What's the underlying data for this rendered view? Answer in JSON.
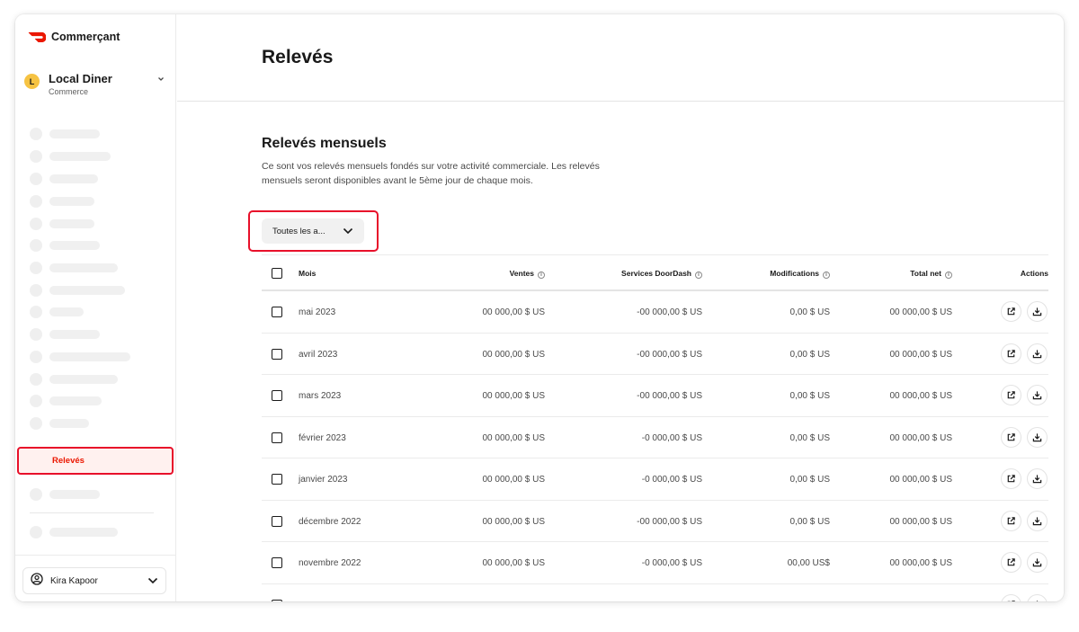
{
  "app": {
    "brand": "Commerçant"
  },
  "store": {
    "avatar_letter": "L",
    "name": "Local Diner",
    "subtitle": "Commerce"
  },
  "sidebar": {
    "active_item": "Relevés"
  },
  "user": {
    "name": "Kira Kapoor"
  },
  "page": {
    "title": "Relevés"
  },
  "section": {
    "title": "Relevés mensuels",
    "description": "Ce sont vos relevés mensuels fondés sur votre activité commerciale. Les relevés mensuels seront disponibles avant le 5ème jour de chaque mois."
  },
  "filter": {
    "label": "Toutes les a..."
  },
  "table": {
    "headers": {
      "month": "Mois",
      "sales": "Ventes",
      "services": "Services DoorDash",
      "modifications": "Modifications",
      "net": "Total net",
      "actions": "Actions"
    },
    "rows": [
      {
        "month": "mai 2023",
        "sales": "00 000,00 $ US",
        "services": "-00 000,00 $ US",
        "modifications": "0,00 $ US",
        "net": "00 000,00 $ US"
      },
      {
        "month": "avril 2023",
        "sales": "00 000,00 $ US",
        "services": "-00 000,00 $ US",
        "modifications": "0,00 $ US",
        "net": "00 000,00 $ US"
      },
      {
        "month": "mars 2023",
        "sales": "00 000,00 $ US",
        "services": "-00 000,00 $ US",
        "modifications": "0,00 $ US",
        "net": "00 000,00 $ US"
      },
      {
        "month": "février 2023",
        "sales": "00 000,00 $ US",
        "services": "-0 000,00 $ US",
        "modifications": "0,00 $ US",
        "net": "00 000,00 $ US"
      },
      {
        "month": "janvier 2023",
        "sales": "00 000,00 $ US",
        "services": "-0 000,00 $ US",
        "modifications": "0,00 $ US",
        "net": "00 000,00 $ US"
      },
      {
        "month": "décembre 2022",
        "sales": "00 000,00 $ US",
        "services": "-00 000,00 $ US",
        "modifications": "0,00 $ US",
        "net": "00 000,00 $ US"
      },
      {
        "month": "novembre 2022",
        "sales": "00 000,00 $ US",
        "services": "-0 000,00 $ US",
        "modifications": "00,00 US$",
        "net": "00 000,00 $ US"
      }
    ]
  },
  "colors": {
    "brand_red": "#eb1700",
    "highlight_border": "#e8102a",
    "active_bg": "#fff1ef",
    "avatar_yellow": "#f6c343"
  },
  "icons": {
    "brand": "doordash-logo-icon",
    "store_toggle": "chevron-down-icon",
    "filter_toggle": "chevron-down-icon",
    "user": "user-circle-icon",
    "user_toggle": "chevron-down-icon",
    "info": "info-icon",
    "open": "external-link-icon",
    "download": "download-icon"
  }
}
